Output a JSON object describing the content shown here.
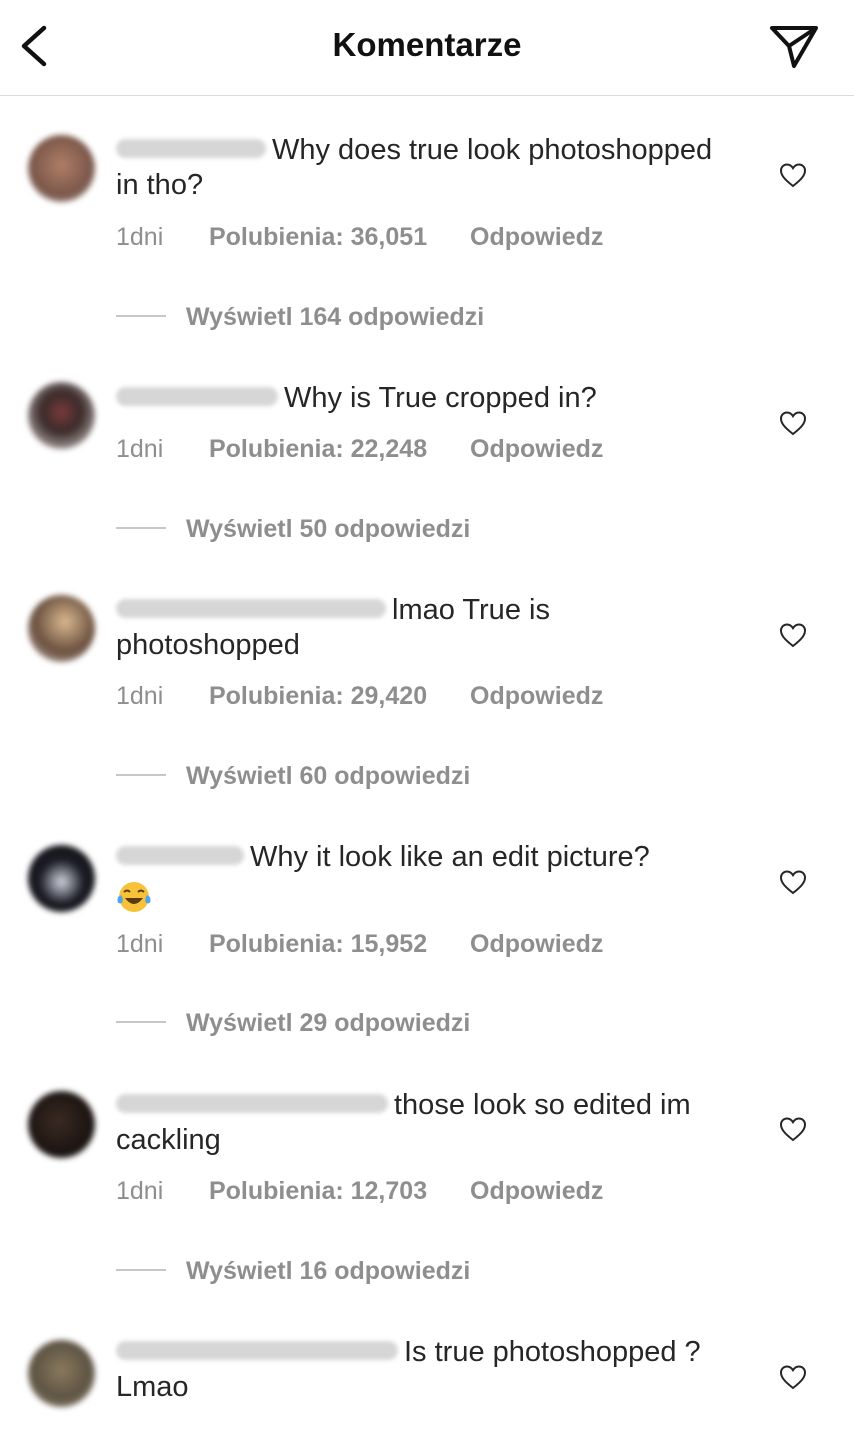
{
  "header": {
    "title": "Komentarze",
    "back_icon": "chevron-left-icon",
    "send_icon": "paper-plane-icon"
  },
  "comments": [
    {
      "text": "Why does true look photoshopped in tho?",
      "time": "1dni",
      "likes": "Polubienia: 36,051",
      "reply": "Odpowiedz",
      "view_replies": "Wyświetl 164 odpowiedzi"
    },
    {
      "text": "Why is True cropped in?",
      "time": "1dni",
      "likes": "Polubienia: 22,248",
      "reply": "Odpowiedz",
      "view_replies": "Wyświetl 50 odpowiedzi"
    },
    {
      "text": "lmao True is photoshopped",
      "time": "1dni",
      "likes": "Polubienia: 29,420",
      "reply": "Odpowiedz",
      "view_replies": "Wyświetl 60 odpowiedzi"
    },
    {
      "text": "Why it look like an edit picture?",
      "emoji": "face-with-tears-of-joy",
      "time": "1dni",
      "likes": "Polubienia: 15,952",
      "reply": "Odpowiedz",
      "view_replies": "Wyświetl 29 odpowiedzi"
    },
    {
      "text": "those look so edited im cackling",
      "time": "1dni",
      "likes": "Polubienia: 12,703",
      "reply": "Odpowiedz",
      "view_replies": "Wyświetl 16 odpowiedzi"
    },
    {
      "text": "Is true photoshopped ? Lmao"
    }
  ],
  "colors": {
    "text": "#262626",
    "secondary": "#8e8e8e",
    "divider": "#dbdbdb"
  }
}
